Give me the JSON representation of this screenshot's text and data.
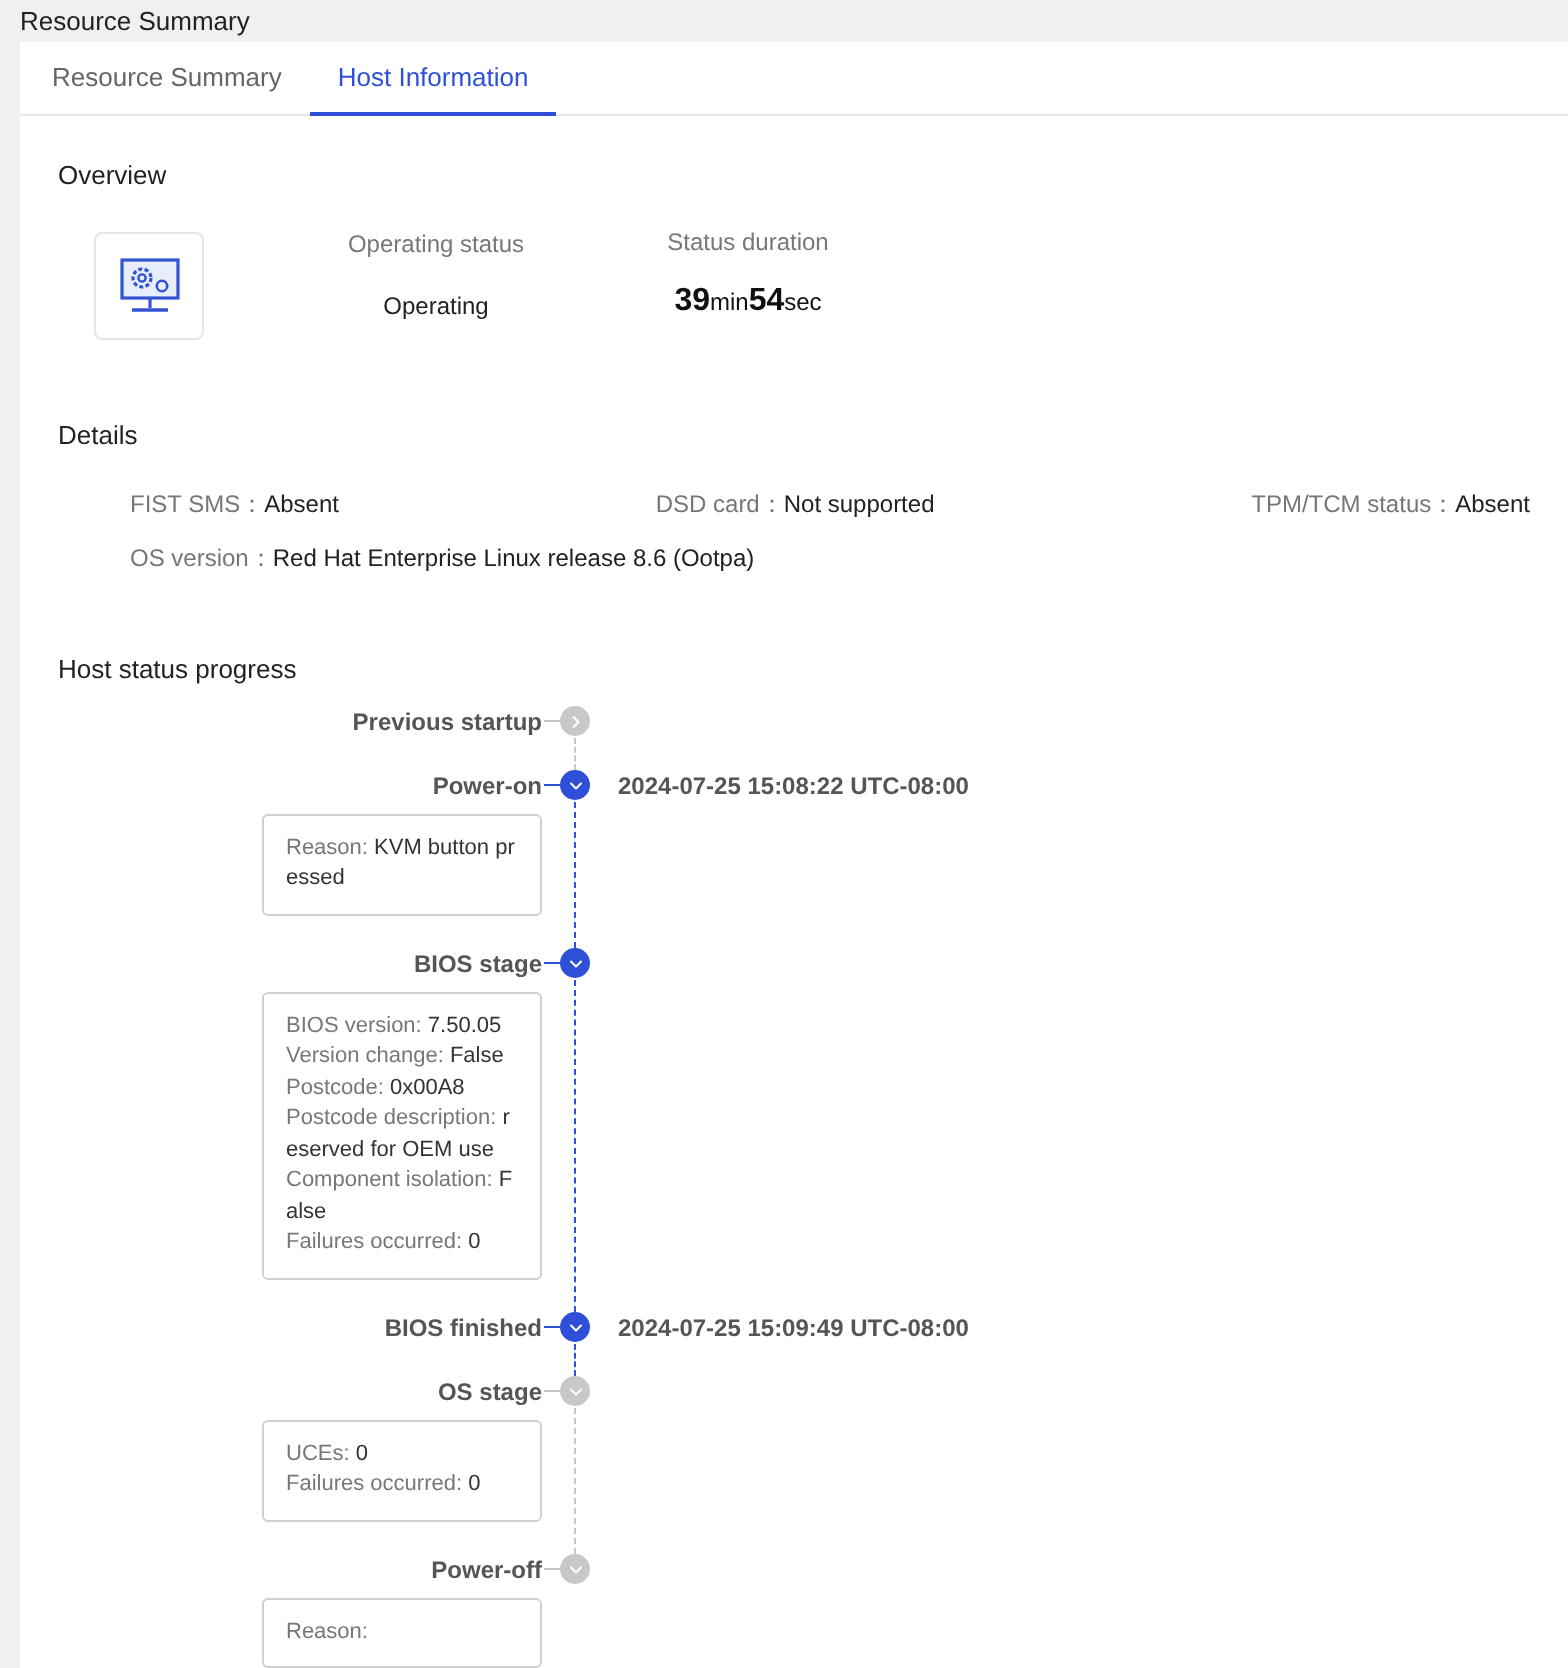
{
  "page_title": "Resource Summary",
  "tabs": [
    {
      "label": "Resource Summary",
      "selected": false
    },
    {
      "label": "Host Information",
      "selected": true
    }
  ],
  "overview": {
    "title": "Overview",
    "status_label": "Operating status",
    "status_value": "Operating",
    "duration_label": "Status duration",
    "duration": [
      {
        "kind": "number",
        "text": "39"
      },
      {
        "kind": "unit",
        "text": "min"
      },
      {
        "kind": "number",
        "text": "54"
      },
      {
        "kind": "unit",
        "text": "sec"
      }
    ]
  },
  "details": {
    "title": "Details",
    "row_1": [
      {
        "label": "FIST SMS：",
        "value": "Absent"
      },
      {
        "label": "DSD card：",
        "value": "Not supported"
      },
      {
        "label": "TPM/TCM status：",
        "value": "Absent"
      }
    ],
    "row_2": [
      {
        "label": "OS version：",
        "value": "Red Hat Enterprise Linux release 8.6 (Ootpa)"
      }
    ]
  },
  "progress": {
    "title": "Host status progress",
    "stages": [
      {
        "label": "Previous startup",
        "active": false,
        "expanded": false
      },
      {
        "label": "Power-on",
        "active": true,
        "expanded": true,
        "time": "2024-07-25 15:08:22 UTC-08:00",
        "fields": [
          {
            "label": "Reason:",
            "value": "KVM button pressed"
          }
        ]
      },
      {
        "label": "BIOS stage",
        "active": true,
        "expanded": true,
        "fields": [
          {
            "label": "BIOS version:",
            "value": "7.50.05"
          },
          {
            "label": "Version change:",
            "value": "False"
          },
          {
            "label": "Postcode:",
            "value": "0x00A8"
          },
          {
            "label": "Postcode description:",
            "value": "reserved for OEM use"
          },
          {
            "label": "Component isolation:",
            "value": "False"
          },
          {
            "label": "Failures occurred:",
            "value": "0"
          }
        ]
      },
      {
        "label": "BIOS finished",
        "active": true,
        "expanded": true,
        "time": "2024-07-25 15:09:49 UTC-08:00"
      },
      {
        "label": "OS stage",
        "active": false,
        "expanded": true,
        "fields": [
          {
            "label": "UCEs:",
            "value": "0"
          },
          {
            "label": "Failures occurred:",
            "value": "0"
          }
        ]
      },
      {
        "label": "Power-off",
        "active": false,
        "expanded": true,
        "fields": [
          {
            "label": "Reason:"
          }
        ]
      }
    ]
  }
}
